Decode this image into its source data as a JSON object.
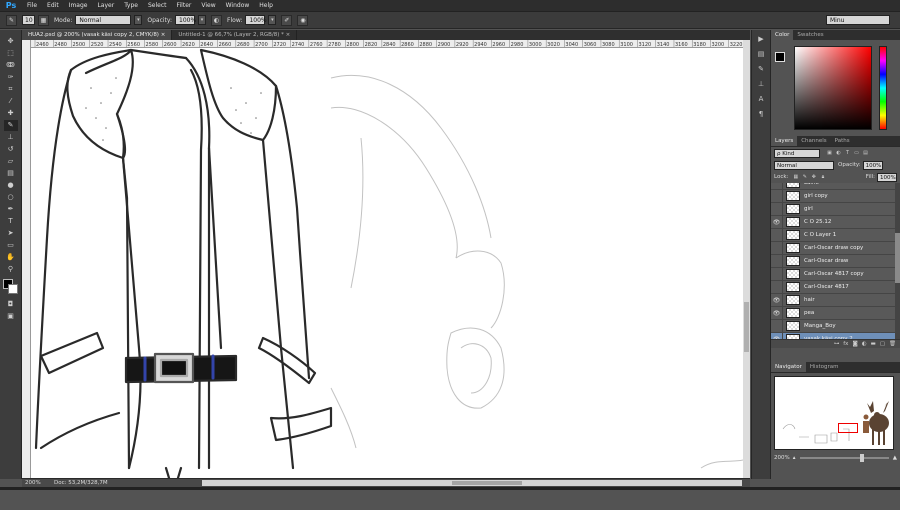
{
  "app": {
    "logo": "Ps"
  },
  "menu": [
    "File",
    "Edit",
    "Image",
    "Layer",
    "Type",
    "Select",
    "Filter",
    "View",
    "Window",
    "Help"
  ],
  "options": {
    "brush_size": "10",
    "mode_label": "Mode:",
    "mode_value": "Normal",
    "opacity_label": "Opacity:",
    "opacity_value": "100%",
    "flow_label": "Flow:",
    "flow_value": "100%",
    "workspace": "Minu"
  },
  "tabs": [
    {
      "label": "HUA2.psd @ 200% (vasak käsi copy 2, CMYK/8)",
      "close": "×"
    },
    {
      "label": "Untitled-1 @ 66,7% (Layer 2, RGB/8) *",
      "close": "×"
    }
  ],
  "ruler_ticks": [
    "2460",
    "2480",
    "2500",
    "2520",
    "2540",
    "2560",
    "2580",
    "2600",
    "2620",
    "2640",
    "2660",
    "2680",
    "2700",
    "2720",
    "2740",
    "2760",
    "2780",
    "2800",
    "2820",
    "2840",
    "2860",
    "2880",
    "2900",
    "2920",
    "2940",
    "2960",
    "2980",
    "3000",
    "3020",
    "3040",
    "3060",
    "3080",
    "3100",
    "3120",
    "3140",
    "3160",
    "3180",
    "3200",
    "3220"
  ],
  "status": {
    "zoom": "200%",
    "doc": "Doc: 53,2M/328,7M"
  },
  "panels": {
    "color_tab": "Color",
    "swatches_tab": "Swatches",
    "layers_tab": "Layers",
    "channels_tab": "Channels",
    "paths_tab": "Paths",
    "kind": "ρ Kind",
    "blend_mode": "Normal",
    "opacity_label": "Opacity:",
    "opacity_value": "100%",
    "lock_label": "Lock:",
    "fill_label": "Fill:",
    "fill_value": "100%",
    "navigator_tab": "Navigator",
    "histogram_tab": "Histogram",
    "nav_zoom": "200%"
  },
  "layers": [
    {
      "name": "Laine",
      "visible": false
    },
    {
      "name": "girl copy",
      "visible": false
    },
    {
      "name": "girl",
      "visible": false
    },
    {
      "name": "C O 25.12",
      "visible": true
    },
    {
      "name": "C O Layer 1",
      "visible": false
    },
    {
      "name": "Carl-Oscar draw copy",
      "visible": false
    },
    {
      "name": "Carl-Oscar draw",
      "visible": false
    },
    {
      "name": "Carl-Oscar 4817 copy",
      "visible": false
    },
    {
      "name": "Carl-Oscar 4817",
      "visible": false
    },
    {
      "name": "hair",
      "visible": true
    },
    {
      "name": "pea",
      "visible": true
    },
    {
      "name": "Manga_Boy",
      "visible": false
    },
    {
      "name": "vasak käsi copy 2",
      "visible": true,
      "selected": true
    }
  ]
}
